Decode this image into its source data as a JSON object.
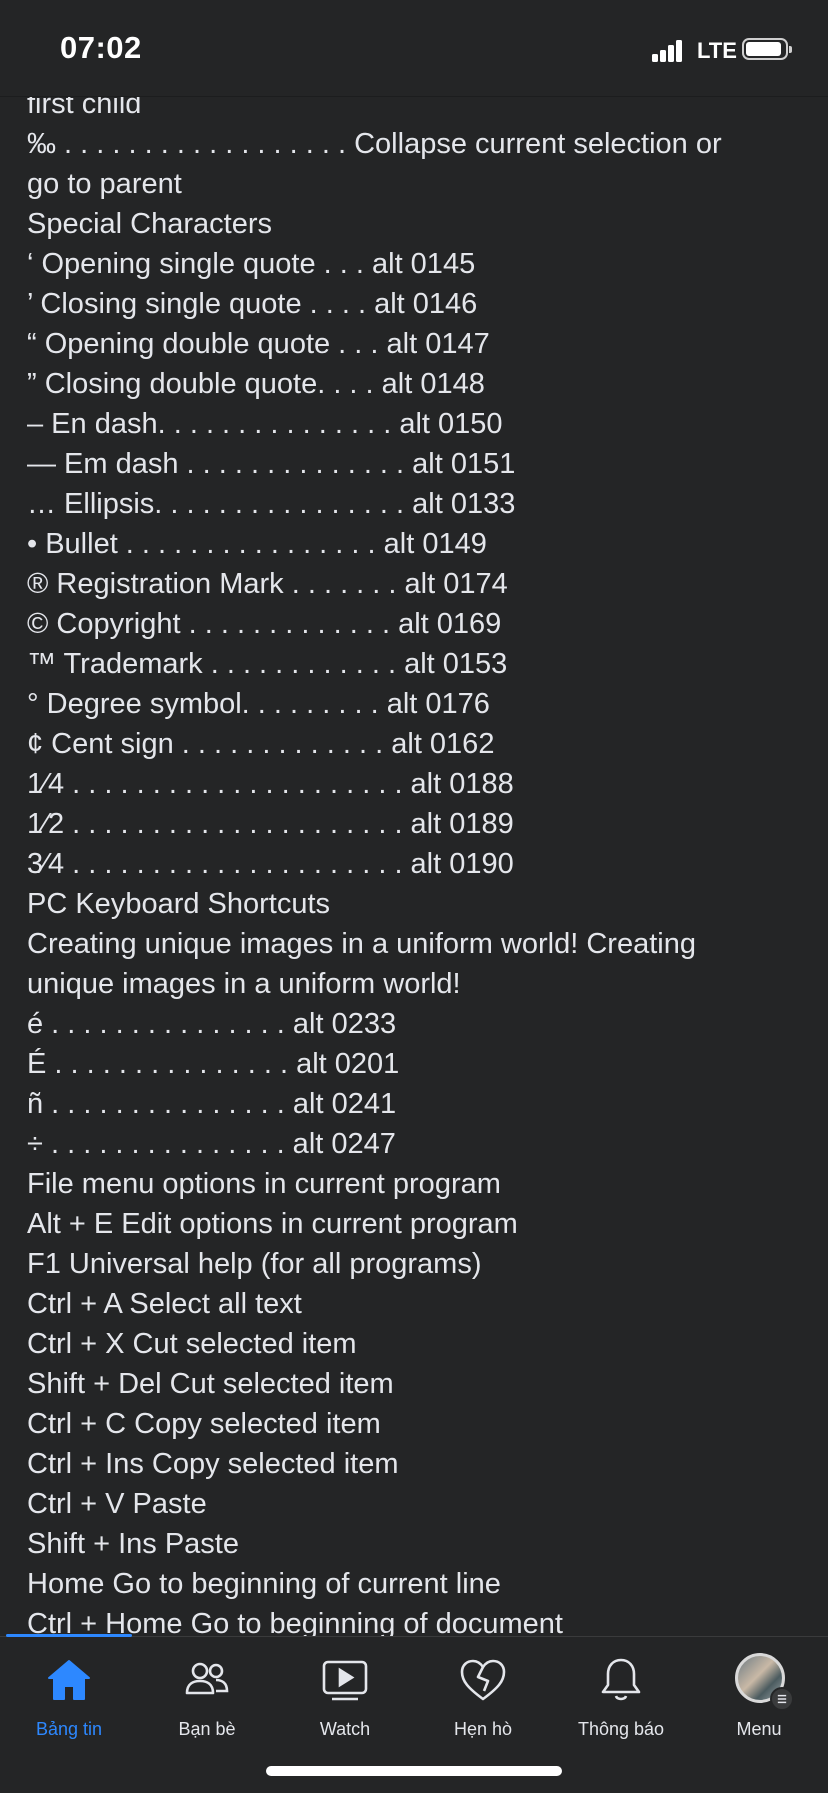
{
  "status_bar": {
    "time": "07:02",
    "network": "LTE"
  },
  "content_lines": [
    "first child",
    "‰ . . . . . . . . . . . . . . . . . . Collapse current selection or",
    "go to parent",
    "Special Characters",
    "‘ Opening single quote . . . alt 0145",
    "’ Closing single quote . . . . alt 0146",
    "“ Opening double quote . . . alt 0147",
    "” Closing double quote. . . . alt 0148",
    "– En dash. . . . . . . . . . . . . . . alt 0150",
    "— Em dash . . . . . . . . . . . . . . alt 0151",
    "… Ellipsis. . . . . . . . . . . . . . . . alt 0133",
    "• Bullet . . . . . . . . . . . . . . . . alt 0149",
    "® Registration Mark . . . . . . . alt 0174",
    "© Copyright . . . . . . . . . . . . . alt 0169",
    "™ Trademark . . . . . . . . . . . . alt 0153",
    "° Degree symbol. . . . . . . . . alt 0176",
    "¢ Cent sign . . . . . . . . . . . . . alt 0162",
    "1⁄4 . . . . . . . . . . . . . . . . . . . . . alt 0188",
    "1⁄2 . . . . . . . . . . . . . . . . . . . . . alt 0189",
    "3⁄4 . . . . . . . . . . . . . . . . . . . . . alt 0190",
    "PC Keyboard Shortcuts",
    "Creating unique images in a uniform world! Creating",
    "unique images in a uniform world!",
    "é . . . . . . . . . . . . . . . alt 0233",
    "É . . . . . . . . . . . . . . . alt 0201",
    "ñ . . . . . . . . . . . . . . . alt 0241",
    "÷ . . . . . . . . . . . . . . . alt 0247",
    "File menu options in current program",
    "Alt + E Edit options in current program",
    "F1 Universal help (for all programs)",
    "Ctrl + A Select all text",
    "Ctrl + X Cut selected item",
    "Shift + Del Cut selected item",
    "Ctrl + C Copy selected item",
    "Ctrl + Ins Copy selected item",
    "Ctrl + V Paste",
    "Shift + Ins Paste",
    "Home Go to beginning of current line",
    "Ctrl + Home Go to beginning of document"
  ],
  "tabs": [
    {
      "label": "Bảng tin",
      "icon": "home-icon",
      "active": true
    },
    {
      "label": "Bạn bè",
      "icon": "friends-icon",
      "active": false
    },
    {
      "label": "Watch",
      "icon": "watch-icon",
      "active": false
    },
    {
      "label": "Hẹn hò",
      "icon": "dating-heart-icon",
      "active": false
    },
    {
      "label": "Thông báo",
      "icon": "bell-icon",
      "active": false
    },
    {
      "label": "Menu",
      "icon": "profile-avatar",
      "active": false
    }
  ],
  "colors": {
    "background": "#242526",
    "text": "#e4e6eb",
    "accent": "#2d88ff"
  }
}
